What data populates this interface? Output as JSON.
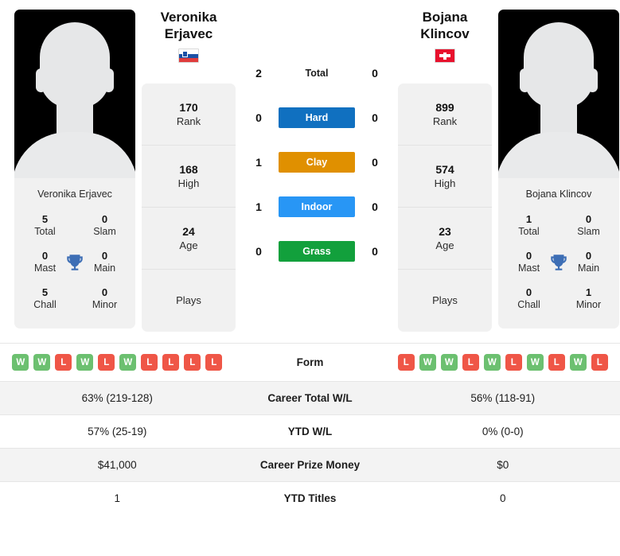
{
  "players": {
    "left": {
      "first_name": "Veronika",
      "last_name": "Erjavec",
      "full_name": "Veronika Erjavec",
      "country_flag": "slovenia-flag",
      "avatar": "player-photo-placeholder",
      "rank": "170",
      "rank_label": "Rank",
      "high": "168",
      "high_label": "High",
      "age": "24",
      "age_label": "Age",
      "plays_label": "Plays",
      "plays_value": "",
      "titles": {
        "total": "5",
        "total_label": "Total",
        "slam": "0",
        "slam_label": "Slam",
        "mast": "0",
        "mast_label": "Mast",
        "main": "0",
        "main_label": "Main",
        "chall": "5",
        "chall_label": "Chall",
        "minor": "0",
        "minor_label": "Minor"
      },
      "form": [
        "W",
        "W",
        "L",
        "W",
        "L",
        "W",
        "L",
        "L",
        "L",
        "L"
      ],
      "career_total_wl": "63% (219-128)",
      "ytd_wl": "57% (25-19)",
      "career_prize_money": "$41,000",
      "ytd_titles": "1"
    },
    "right": {
      "first_name": "Bojana",
      "last_name": "Klincov",
      "full_name": "Bojana Klincov",
      "country_flag": "switzerland-flag",
      "avatar": "player-photo-placeholder",
      "rank": "899",
      "rank_label": "Rank",
      "high": "574",
      "high_label": "High",
      "age": "23",
      "age_label": "Age",
      "plays_label": "Plays",
      "plays_value": "",
      "titles": {
        "total": "1",
        "total_label": "Total",
        "slam": "0",
        "slam_label": "Slam",
        "mast": "0",
        "mast_label": "Mast",
        "main": "0",
        "main_label": "Main",
        "chall": "0",
        "chall_label": "Chall",
        "minor": "1",
        "minor_label": "Minor"
      },
      "form": [
        "L",
        "W",
        "W",
        "L",
        "W",
        "L",
        "W",
        "L",
        "W",
        "L"
      ],
      "career_total_wl": "56% (118-91)",
      "ytd_wl": "0% (0-0)",
      "career_prize_money": "$0",
      "ytd_titles": "0"
    }
  },
  "head_to_head": [
    {
      "label": "Total",
      "left": "2",
      "right": "0",
      "type": "plain",
      "color": ""
    },
    {
      "label": "Hard",
      "left": "0",
      "right": "0",
      "type": "badge",
      "color": "#1070c0"
    },
    {
      "label": "Clay",
      "left": "1",
      "right": "0",
      "type": "badge",
      "color": "#e09000"
    },
    {
      "label": "Indoor",
      "left": "1",
      "right": "0",
      "type": "badge",
      "color": "#2896f5"
    },
    {
      "label": "Grass",
      "left": "0",
      "right": "0",
      "type": "badge",
      "color": "#12a03c"
    }
  ],
  "comparison_rows": [
    {
      "label": "Form",
      "type": "form"
    },
    {
      "label": "Career Total W/L",
      "type": "text",
      "left": "63% (219-128)",
      "right": "56% (118-91)"
    },
    {
      "label": "YTD W/L",
      "type": "text",
      "left": "57% (25-19)",
      "right": "0% (0-0)"
    },
    {
      "label": "Career Prize Money",
      "type": "text",
      "left": "$41,000",
      "right": "$0"
    },
    {
      "label": "YTD Titles",
      "type": "text",
      "left": "1",
      "right": "0"
    }
  ],
  "colors": {
    "win_badge": "#6cc070",
    "loss_badge": "#ef5647",
    "trophy": "#3d6eb5",
    "panel_bg": "#f1f1f1",
    "row_alt_bg": "#f3f3f3"
  },
  "icons": {
    "trophy": "trophy-icon"
  }
}
